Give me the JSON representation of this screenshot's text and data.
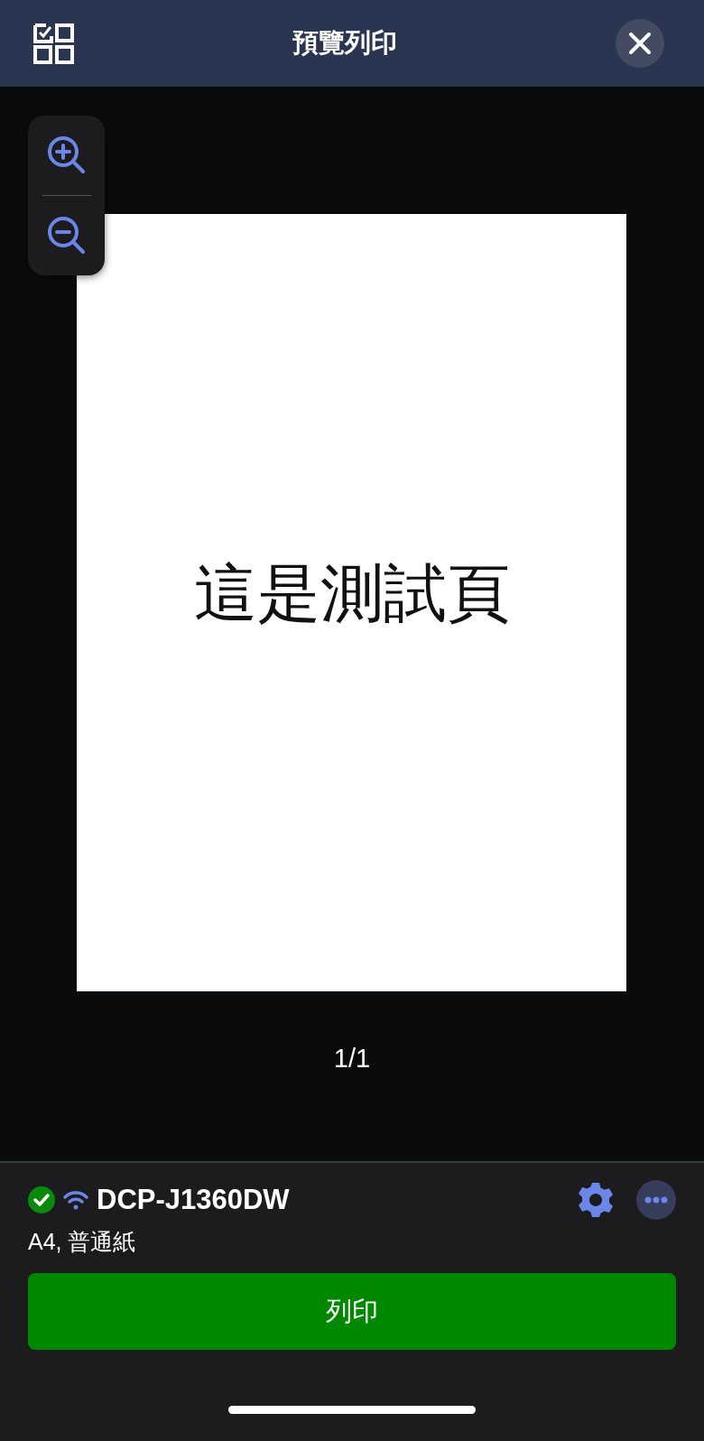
{
  "header": {
    "title": "預覽列印"
  },
  "preview": {
    "page_text": "這是測試頁",
    "page_counter": "1/1"
  },
  "printer": {
    "name": "DCP-J1360DW",
    "connected": true,
    "settings_summary": "A4, 普通紙"
  },
  "print_button": {
    "label": "列印"
  }
}
